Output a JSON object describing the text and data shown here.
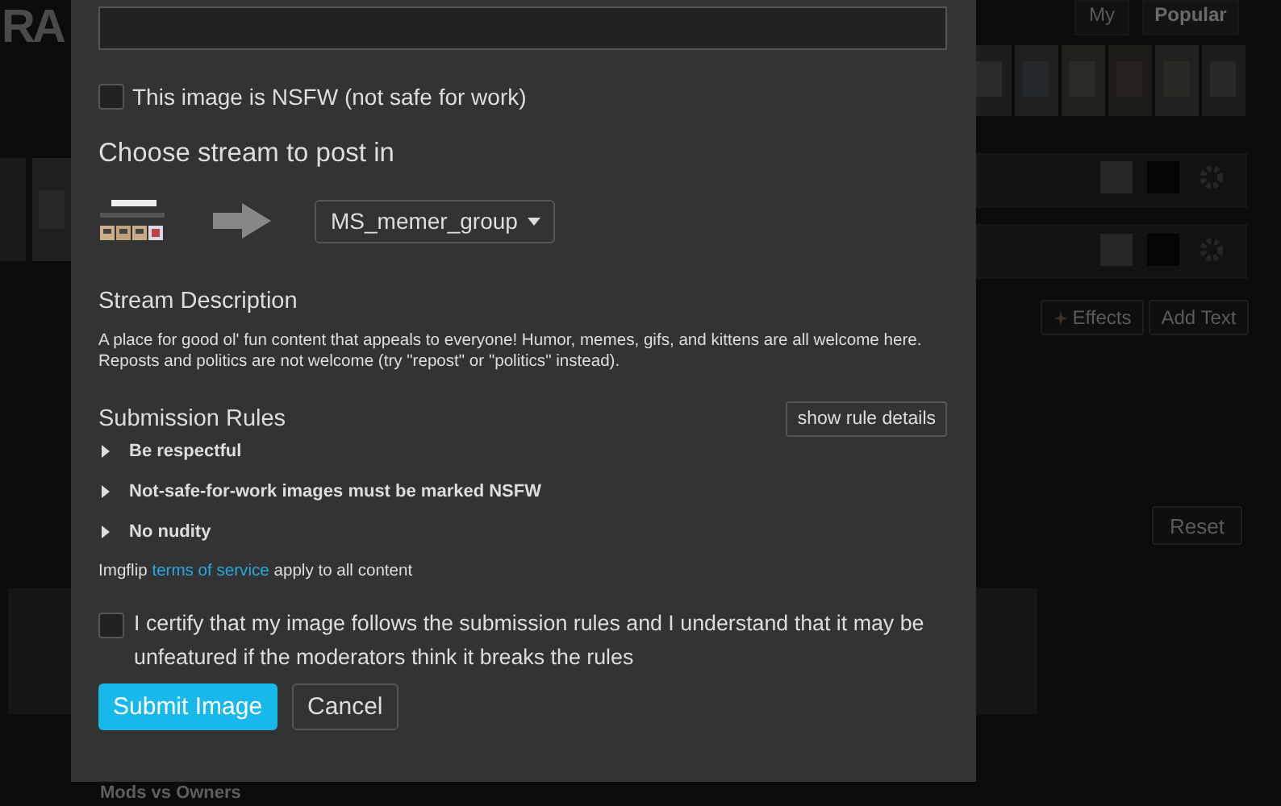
{
  "background": {
    "logo": "RA",
    "tabs": [
      {
        "label": "My",
        "selected": false
      },
      {
        "label": "Popular",
        "selected": true
      }
    ],
    "buttons": [
      {
        "label": "Effects",
        "kind": "effects"
      },
      {
        "label": "Add Text",
        "kind": "plain"
      },
      {
        "label": "Reset",
        "kind": "reset"
      }
    ],
    "list_item": "Mods vs Owners"
  },
  "modal": {
    "nsfw": {
      "label": "This image is NSFW (not safe for work)",
      "checked": false
    },
    "stream": {
      "heading": "Choose stream to post in",
      "selected_stream": "MS_memer_group"
    },
    "description": {
      "heading": "Stream Description",
      "text": "A place for good ol' fun content that appeals to everyone! Humor, memes, gifs, and kittens are all welcome here. Reposts and politics are not welcome (try \"repost\" or \"politics\" instead)."
    },
    "rules": {
      "heading": "Submission Rules",
      "details_button": "show rule details",
      "items": [
        "Be respectful",
        "Not-safe-for-work images must be marked NSFW",
        "No nudity"
      ]
    },
    "terms": {
      "before": "Imgflip",
      "link": "terms of service",
      "after": "apply to all content"
    },
    "certify": {
      "label": "I certify that my image follows the submission rules and I understand that it may be unfeatured if the moderators think it breaks the rules",
      "checked": false
    },
    "buttons": [
      {
        "label": "Submit Image",
        "kind": "primary"
      },
      {
        "label": "Cancel",
        "kind": "secondary"
      }
    ]
  }
}
